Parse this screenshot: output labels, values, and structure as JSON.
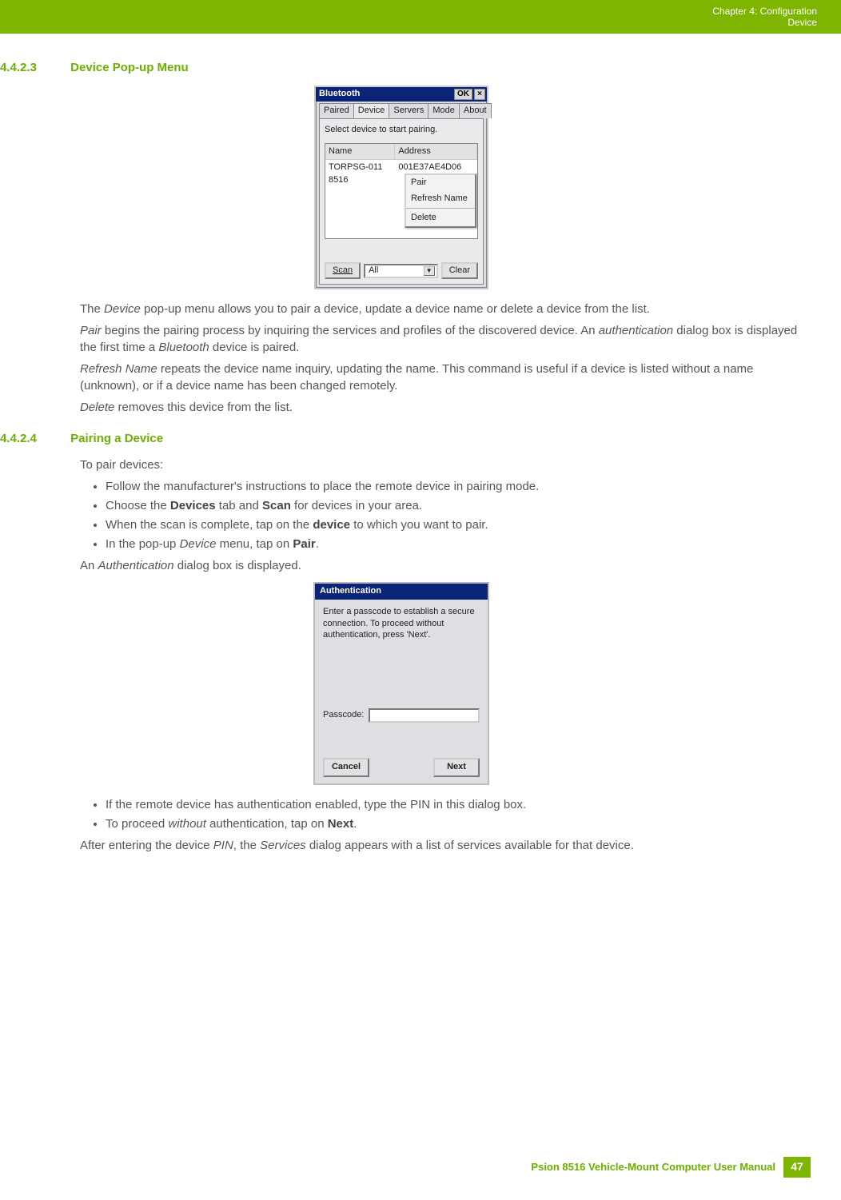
{
  "header": {
    "chapter": "Chapter 4:  Configuration",
    "sub": "Device"
  },
  "sections": {
    "s1": {
      "num": "4.4.2.3",
      "title": "Device Pop-up Menu"
    },
    "s2": {
      "num": "4.4.2.4",
      "title": "Pairing a Device"
    }
  },
  "bt_dialog": {
    "window_title": "Bluetooth",
    "ok_label": "OK",
    "tabs": {
      "paired": "Paired",
      "device": "Device",
      "servers": "Servers",
      "mode": "Mode",
      "about": "About"
    },
    "subtitle": "Select device to start pairing.",
    "columns": {
      "name": "Name",
      "address": "Address"
    },
    "row": {
      "name": "TORPSG-011 8516",
      "address": "001E37AE4D06"
    },
    "context": {
      "pair": "Pair",
      "refresh": "Refresh Name",
      "delete": "Delete"
    },
    "footer": {
      "scan": "Scan",
      "dropdown": "All",
      "clear": "Clear"
    }
  },
  "body1": {
    "p1a": "The ",
    "p1b": "Device",
    "p1c": " pop-up menu allows you to pair a device, update a device name or delete a device from the list.",
    "p2a": "Pair",
    "p2b": " begins the pairing process by inquiring the services and profiles of the discovered device. An ",
    "p2c": "authentication",
    "p2d": " dialog box is displayed the first time a ",
    "p2e": "Bluetooth",
    "p2f": " device is paired.",
    "p3a": "Refresh Name",
    "p3b": " repeats the device name inquiry, updating the name. This command is useful if a device is listed without a name (unknown), or if a device name has been changed remotely.",
    "p4a": "Delete",
    "p4b": " removes this device from the list."
  },
  "body2": {
    "intro": "To pair devices:",
    "b1": "Follow the manufacturer's instructions to place the remote device in pairing mode.",
    "b2a": "Choose the ",
    "b2b": "Devices",
    "b2c": " tab and ",
    "b2d": "Scan",
    "b2e": " for devices in your area.",
    "b3a": "When the scan is complete, tap on the ",
    "b3b": "device",
    "b3c": " to which you want to pair.",
    "b4a": "In the pop-up ",
    "b4b": "Device",
    "b4c": " menu, tap on ",
    "b4d": "Pair",
    "b4e": ".",
    "outro_a": "An ",
    "outro_b": "Authentication",
    "outro_c": " dialog box is displayed."
  },
  "auth_dialog": {
    "title": "Authentication",
    "msg": "Enter a passcode to establish a secure connection. To proceed without authentication, press 'Next'.",
    "pass_label": "Passcode:",
    "cancel": "Cancel",
    "next": "Next"
  },
  "body3": {
    "b1": "If the remote device has authentication enabled, type the PIN in this dialog box.",
    "b2a": "To proceed ",
    "b2b": "without",
    "b2c": " authentication, tap on ",
    "b2d": "Next",
    "b2e": ".",
    "outro_a": "After entering the device ",
    "outro_b": "PIN",
    "outro_c": ", the ",
    "outro_d": "Services",
    "outro_e": " dialog appears with a list of services available for that device."
  },
  "footer": {
    "text": "Psion 8516 Vehicle-Mount Computer User Manual",
    "page": "47"
  }
}
